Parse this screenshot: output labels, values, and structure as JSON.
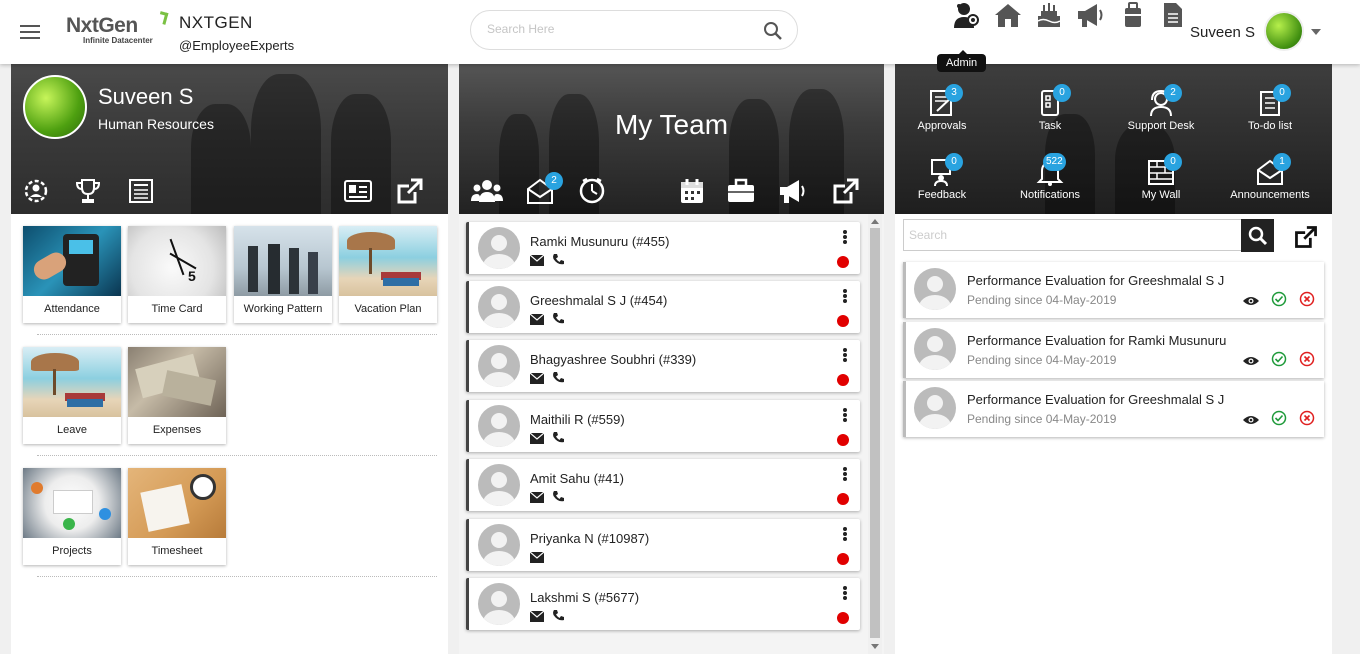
{
  "header": {
    "logo_brand": "NxtGen",
    "logo_tagline": "Infinite Datacenter",
    "company_name": "NXTGEN",
    "company_handle": "@EmployeeExperts",
    "search_placeholder": "Search Here",
    "tooltip": "Admin",
    "user_name": "Suveen S"
  },
  "profile": {
    "name": "Suveen S",
    "department": "Human Resources"
  },
  "tiles": [
    {
      "label": "Attendance"
    },
    {
      "label": "Time Card"
    },
    {
      "label": "Working Pattern"
    },
    {
      "label": "Vacation Plan"
    },
    {
      "label": "Leave"
    },
    {
      "label": "Expenses"
    },
    {
      "label": "Projects"
    },
    {
      "label": "Timesheet"
    }
  ],
  "team": {
    "title": "My Team",
    "messages_badge": "2",
    "members": [
      {
        "name": "Ramki Musunuru (#455)"
      },
      {
        "name": "Greeshmalal S J (#454)"
      },
      {
        "name": "Bhagyashree Soubhri (#339)"
      },
      {
        "name": "Maithili R (#559)"
      },
      {
        "name": "Amit Sahu (#41)"
      },
      {
        "name": "Priyanka N (#10987)"
      },
      {
        "name": "Lakshmi S (#5677)"
      }
    ]
  },
  "quick": [
    {
      "label": "Approvals",
      "count": "3",
      "icon": "approvals-icon"
    },
    {
      "label": "Task",
      "count": "0",
      "icon": "task-icon"
    },
    {
      "label": "Support Desk",
      "count": "2",
      "icon": "support-desk-icon"
    },
    {
      "label": "To-do list",
      "count": "0",
      "icon": "todo-list-icon"
    },
    {
      "label": "Feedback",
      "count": "0",
      "icon": "feedback-icon"
    },
    {
      "label": "Notifications",
      "count": "522",
      "icon": "bell-icon"
    },
    {
      "label": "My Wall",
      "count": "0",
      "icon": "wall-icon"
    },
    {
      "label": "Announcements",
      "count": "1",
      "icon": "envelope-icon"
    }
  ],
  "pending": {
    "search_placeholder": "Search",
    "items": [
      {
        "title": "Performance Evaluation for Greeshmalal S J",
        "subtitle": "Pending since 04-May-2019"
      },
      {
        "title": "Performance Evaluation for Ramki Musunuru",
        "subtitle": "Pending since 04-May-2019"
      },
      {
        "title": "Performance Evaluation for Greeshmalal S J",
        "subtitle": "Pending since 04-May-2019"
      }
    ]
  },
  "colors": {
    "badge": "#29a3e0",
    "status_red": "#e10000",
    "approve_green": "#1f9a3a",
    "reject_red": "#e02020"
  }
}
